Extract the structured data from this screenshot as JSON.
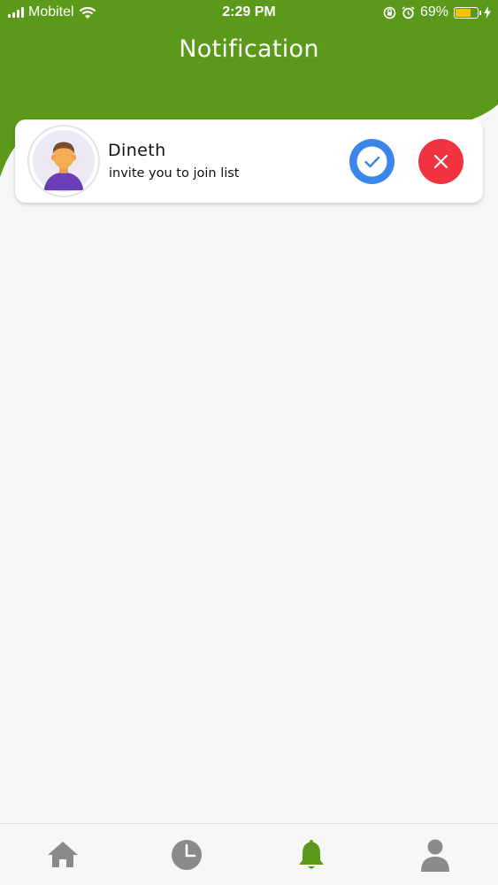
{
  "status_bar": {
    "carrier": "Mobitel",
    "time": "2:29 PM",
    "battery": "69%",
    "battery_level": 0.69
  },
  "header": {
    "title": "Notification"
  },
  "notifications": [
    {
      "name": "Dineth",
      "message": "invite you to join list",
      "avatar_icon": "user-avatar-icon",
      "accept_icon": "check-icon",
      "reject_icon": "close-icon"
    }
  ],
  "bottom_nav": {
    "items": [
      {
        "icon": "home-icon",
        "active": false
      },
      {
        "icon": "clock-icon",
        "active": false
      },
      {
        "icon": "bell-icon",
        "active": true
      },
      {
        "icon": "profile-icon",
        "active": false
      }
    ]
  },
  "colors": {
    "brand_green": "#5b991a",
    "accept_blue": "#3a86ea",
    "reject_red": "#f0333f",
    "nav_inactive": "#8a8a8a",
    "nav_active": "#5b991a"
  }
}
